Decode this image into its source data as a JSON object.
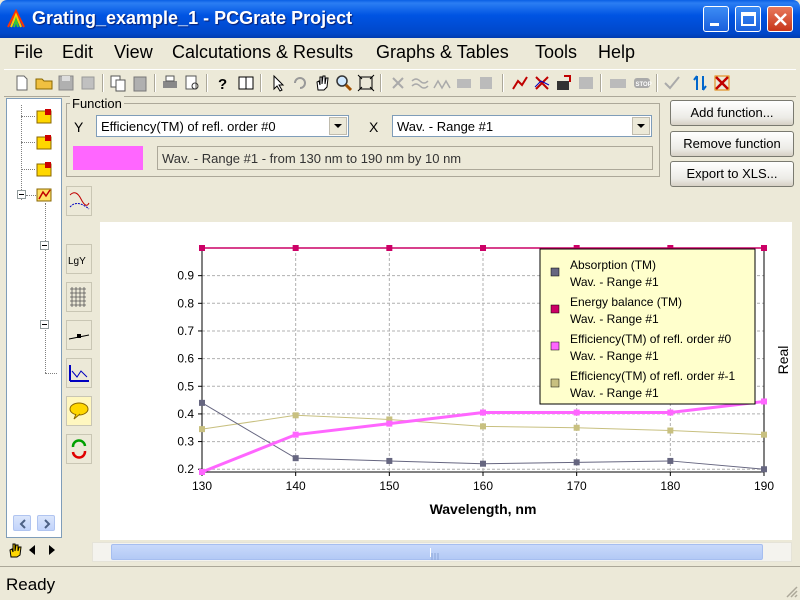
{
  "window": {
    "title": "Grating_example_1 - PCGrate Project",
    "controls": [
      "minimize-icon",
      "maximize-icon",
      "close-icon"
    ]
  },
  "menu": [
    "File",
    "Edit",
    "View",
    "Calcutations & Results",
    "Graphs & Tables",
    "Tools",
    "Help"
  ],
  "function_panel": {
    "legend": "Function",
    "y_label": "Y",
    "y_value": "Efficiency(TM) of refl. order #0",
    "x_label": "X",
    "x_value": "Wav. - Range #1",
    "range_text": "Wav. - Range #1 - from 130 nm to 190 nm by 10 nm",
    "swatch_color": "#ff66ff"
  },
  "buttons": {
    "add_function": "Add function...",
    "remove_function": "Remove function",
    "export_xls": "Export to XLS..."
  },
  "status": {
    "text": "Ready"
  },
  "colors": {
    "absorption": "#666680",
    "energy_balance": "#cc0066",
    "efficiency_order0": "#ff66ff",
    "efficiency_order_m1": "#c8c080",
    "legend_bg": "#ffffcc"
  },
  "chart_data": {
    "type": "line",
    "xlabel": "Wavelength, nm",
    "ylabel": "Real",
    "x": [
      130,
      140,
      150,
      160,
      170,
      180,
      190
    ],
    "xlim": [
      130,
      190
    ],
    "ylim": [
      0.19,
      1.0
    ],
    "xticks": [
      "130",
      "140",
      "150",
      "160",
      "170",
      "180",
      "190"
    ],
    "yticks": [
      "0.2",
      "0.3",
      "0.4",
      "0.5",
      "0.6",
      "0.7",
      "0.8",
      "0.9"
    ],
    "grid": true,
    "legend_placement": "top-right",
    "series": [
      {
        "name": "Absorption (TM)",
        "sub": "Wav. - Range #1",
        "values": [
          0.44,
          0.24,
          0.23,
          0.22,
          0.225,
          0.23,
          0.2
        ]
      },
      {
        "name": "Energy balance (TM)",
        "sub": "Wav. - Range #1",
        "values": [
          1.0,
          1.0,
          1.0,
          1.0,
          1.0,
          1.0,
          1.0
        ]
      },
      {
        "name": "Efficiency(TM) of refl. order #0",
        "sub": "Wav. - Range #1",
        "values": [
          0.19,
          0.325,
          0.365,
          0.405,
          0.405,
          0.405,
          0.445
        ]
      },
      {
        "name": "Efficiency(TM) of refl. order #-1",
        "sub": "Wav. - Range #1",
        "values": [
          0.345,
          0.395,
          0.38,
          0.355,
          0.35,
          0.34,
          0.325
        ]
      }
    ]
  }
}
